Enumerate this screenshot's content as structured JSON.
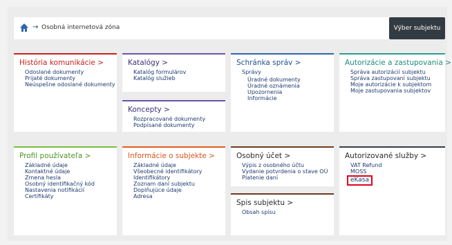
{
  "topbar": {
    "arrow": "→",
    "breadcrumb": "Osobná internetová zóna",
    "subject_button": "Výber subjektu"
  },
  "cards": {
    "historia": {
      "title": "História komunikácie >",
      "items": [
        "Odoslané dokumenty",
        "Prijaté dokumenty",
        "Neúspešne odoslané dokumenty"
      ]
    },
    "katalogy": {
      "title": "Katalógy >",
      "items": [
        "Katalóg formulárov",
        "Katalóg služieb"
      ]
    },
    "koncepty": {
      "title": "Koncepty >",
      "items": [
        "Rozpracované dokumenty",
        "Podpísané dokumenty"
      ]
    },
    "schranka": {
      "title": "Schránka správ >",
      "items": [
        "Správy"
      ],
      "subitems": [
        "Úradné dokumenty",
        "Úradné oznámenia",
        "Upozornenia",
        "Informácie"
      ]
    },
    "autorizacie": {
      "title": "Autorizácie a zastupovania >",
      "items": [
        "Správa autorizácií subjektu",
        "Správa zastupovaní subjektu",
        "Moje autorizácie k subjektom",
        "Moje zastupovania subjektov"
      ]
    },
    "profil": {
      "title": "Profil používateľa >",
      "items": [
        "Základné údaje",
        "Kontaktné údaje",
        "Zmena hesla",
        "Osobný identifikačný kód",
        "Nastavenia notifikácií",
        "Certifikáty"
      ]
    },
    "informacie": {
      "title": "Informácie o subjekte >",
      "items": [
        "Základné údaje",
        "Všeobecné identifikátory",
        "Identifikátory",
        "Zoznam daní subjektu",
        "Doplňujúce údaje",
        "Adresa"
      ]
    },
    "osobny_ucet": {
      "title": "Osobný účet >",
      "items": [
        "Výpis z osobného účtu",
        "Vydanie potvrdenia o stave OÚ",
        "Platenie daní"
      ]
    },
    "spis": {
      "title": "Spis subjektu >",
      "items": [
        "Obsah spisu"
      ]
    },
    "autorizovane": {
      "title": "Autorizované služby >",
      "items": [
        "VAT Refund",
        "MOSS"
      ],
      "highlighted": "eKasa"
    }
  },
  "colors": {
    "red": "#c9201c",
    "purple": "#6b53a6",
    "blue": "#2f66ad",
    "teal": "#2a9e8c",
    "green": "#7cb83e",
    "orange": "#e15a1e",
    "brown": "#6b3a1f",
    "dark": "#333b42",
    "link": "#1d3a6e",
    "highlight_box": "#e3001b"
  },
  "icons": {
    "home": "home-icon"
  }
}
